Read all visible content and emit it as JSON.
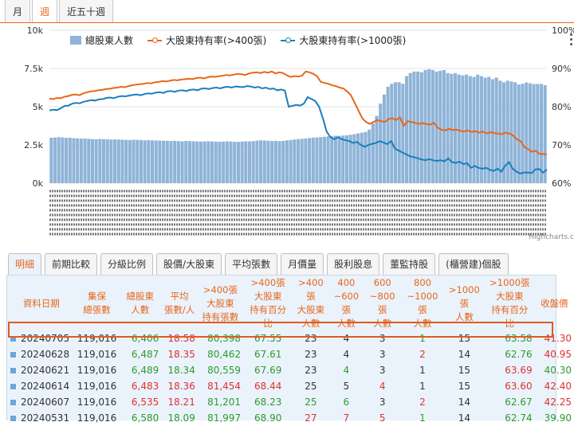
{
  "top_tabs": [
    "月",
    "週",
    "近五十週"
  ],
  "active_top_tab": 1,
  "credit": "Highcharts.c",
  "chart_data": {
    "type": "bar+line",
    "series": [
      {
        "name": "總股東人數",
        "axis": "left",
        "color": "#8fb4d8",
        "values": [
          2970,
          2980,
          3010,
          2990,
          2960,
          2970,
          2940,
          2930,
          2910,
          2920,
          2900,
          2880,
          2870,
          2890,
          2880,
          2870,
          2850,
          2860,
          2850,
          2840,
          2830,
          2820,
          2840,
          2830,
          2820,
          2800,
          2810,
          2800,
          2790,
          2780,
          2780,
          2770,
          2760,
          2770,
          2750,
          2740,
          2760,
          2750,
          2740,
          2730,
          2720,
          2730,
          2740,
          2730,
          2720,
          2710,
          2720,
          2730,
          2720,
          2710,
          2700,
          2720,
          2740,
          2730,
          2750,
          2780,
          2800,
          2790,
          2780,
          2760,
          2770,
          2750,
          2760,
          2800,
          2820,
          2860,
          2880,
          2900,
          2920,
          2950,
          2980,
          2990,
          3010,
          3030,
          3060,
          3080,
          3100,
          3090,
          3110,
          3130,
          3160,
          3200,
          3250,
          3300,
          3350,
          3500,
          3900,
          4400,
          5200,
          5800,
          6300,
          6500,
          6600,
          6600,
          6500,
          7000,
          7200,
          7300,
          7300,
          7250,
          7400,
          7450,
          7400,
          7300,
          7350,
          7400,
          7200,
          7150,
          7200,
          7100,
          7050,
          7100,
          7000,
          6950,
          7100,
          7000,
          6900,
          6950,
          6800,
          6900,
          6700,
          6600,
          6700,
          6650,
          6600,
          6450,
          6500,
          6580,
          6535,
          6483,
          6489,
          6487,
          6406
        ]
      },
      {
        "name": "大股東持有率(>400張)",
        "axis": "right",
        "color": "#e8661a",
        "values": [
          82.1,
          82.0,
          82.3,
          82.2,
          82.6,
          82.8,
          83.1,
          83.2,
          83.0,
          83.5,
          83.8,
          84.0,
          84.1,
          84.3,
          84.4,
          84.6,
          84.7,
          84.9,
          85.0,
          85.2,
          85.1,
          85.4,
          85.6,
          85.8,
          85.9,
          86.0,
          86.2,
          86.1,
          86.4,
          86.5,
          86.7,
          86.6,
          86.8,
          87.0,
          86.9,
          87.1,
          87.2,
          87.3,
          87.2,
          87.5,
          87.6,
          87.4,
          87.7,
          87.9,
          87.8,
          88.0,
          88.1,
          88.3,
          88.2,
          88.4,
          88.6,
          88.5,
          88.3,
          88.7,
          88.9,
          89.0,
          88.8,
          89.1,
          88.9,
          89.2,
          88.7,
          89.0,
          88.8,
          88.2,
          87.8,
          88.0,
          87.9,
          88.1,
          89.2,
          89.0,
          88.6,
          88.0,
          86.5,
          86.2,
          86.0,
          85.6,
          85.4,
          85.0,
          84.8,
          84.0,
          83.0,
          81.0,
          79.0,
          77.0,
          76.0,
          75.5,
          76.0,
          76.5,
          76.2,
          76.0,
          76.8,
          77.0,
          76.5,
          77.2,
          75.0,
          76.2,
          76.0,
          75.8,
          75.5,
          75.7,
          75.5,
          75.3,
          75.8,
          74.5,
          74.0,
          73.8,
          74.2,
          73.9,
          74.0,
          73.7,
          73.5,
          73.8,
          73.4,
          73.6,
          73.2,
          73.5,
          73.0,
          73.3,
          73.1,
          73.0,
          72.8,
          73.2,
          73.0,
          72.5,
          71.5,
          71.0,
          69.5,
          68.9,
          68.23,
          68.44,
          67.69,
          67.61,
          67.55
        ]
      },
      {
        "name": "大股東持有率(>1000張)",
        "axis": "right",
        "color": "#1a7fbd",
        "values": [
          79.0,
          79.2,
          79.1,
          79.6,
          80.2,
          80.3,
          80.8,
          81.0,
          80.9,
          81.3,
          81.5,
          81.7,
          81.6,
          81.9,
          82.0,
          82.3,
          82.4,
          82.2,
          82.6,
          82.8,
          82.7,
          82.9,
          83.1,
          83.2,
          83.0,
          83.3,
          83.5,
          83.4,
          83.7,
          83.8,
          83.6,
          84.0,
          84.1,
          83.9,
          84.2,
          84.3,
          84.1,
          84.4,
          84.5,
          84.3,
          84.7,
          84.8,
          84.6,
          84.9,
          85.0,
          84.8,
          85.1,
          85.2,
          85.0,
          85.3,
          85.2,
          85.1,
          85.4,
          85.3,
          85.0,
          85.2,
          84.8,
          85.0,
          84.6,
          84.8,
          84.3,
          84.5,
          84.2,
          80.0,
          80.2,
          80.5,
          80.3,
          80.8,
          82.5,
          82.0,
          81.5,
          80.0,
          77.0,
          73.5,
          72.0,
          71.5,
          72.0,
          71.5,
          71.2,
          71.0,
          70.5,
          70.8,
          70.0,
          69.5,
          70.0,
          70.3,
          70.5,
          71.0,
          70.6,
          70.2,
          71.0,
          69.0,
          68.5,
          68.0,
          67.5,
          67.0,
          66.8,
          66.5,
          66.2,
          66.0,
          66.3,
          66.0,
          65.8,
          66.0,
          65.7,
          66.5,
          65.5,
          65.3,
          65.6,
          65.0,
          65.2,
          64.0,
          64.5,
          64.0,
          63.8,
          64.0,
          63.5,
          63.2,
          63.8,
          63.0,
          64.5,
          65.5,
          63.8,
          63.0,
          62.5,
          62.8,
          62.74,
          62.67,
          63.6,
          63.69,
          62.76,
          63.58
        ]
      }
    ],
    "left_axis": {
      "ticks": [
        "0k",
        "2.5k",
        "5k",
        "7.5k",
        "10k"
      ],
      "range": [
        0,
        10000
      ]
    },
    "right_axis": {
      "ticks": [
        "60%",
        "70%",
        "80%",
        "90%",
        "100%"
      ],
      "range": [
        60,
        100
      ]
    },
    "grid": true,
    "legend": "top"
  },
  "sub_tabs": [
    "明細",
    "前期比較",
    "分級比例",
    "股價/大股東",
    "平均張數",
    "月價量",
    "股利股息",
    "董監持股",
    "(櫃營建)個股"
  ],
  "active_sub_tab": 0,
  "table": {
    "headers": [
      [
        "資料日期"
      ],
      [
        "集保",
        "總張數"
      ],
      [
        "總股東",
        "人數"
      ],
      [
        "平均",
        "張數/人"
      ],
      [
        ">400張",
        "大股東",
        "持有張數"
      ],
      [
        ">400張",
        "大股東",
        "持有百分比"
      ],
      [
        ">400張",
        "大股東",
        "人數"
      ],
      [
        "400",
        "~600張",
        "人數"
      ],
      [
        "600",
        "~800張",
        "人數"
      ],
      [
        "800",
        "~1000張",
        "人數"
      ],
      [
        ">1000張",
        "人數"
      ],
      [
        ">1000張",
        "大股東",
        "持有百分比"
      ],
      [
        "收盤價"
      ]
    ],
    "rows": [
      [
        "20240705",
        "119,016",
        "6,406",
        "18.58",
        "80,398",
        "67.55",
        "23",
        "4",
        "3",
        "1",
        "15",
        "63.58",
        "41.30"
      ],
      [
        "20240628",
        "119,016",
        "6,487",
        "18.35",
        "80,462",
        "67.61",
        "23",
        "4",
        "3",
        "2",
        "14",
        "62.76",
        "40.95"
      ],
      [
        "20240621",
        "119,016",
        "6,489",
        "18.34",
        "80,559",
        "67.69",
        "23",
        "4",
        "3",
        "1",
        "15",
        "63.69",
        "40.30"
      ],
      [
        "20240614",
        "119,016",
        "6,483",
        "18.36",
        "81,454",
        "68.44",
        "25",
        "5",
        "4",
        "1",
        "15",
        "63.60",
        "42.40"
      ],
      [
        "20240607",
        "119,016",
        "6,535",
        "18.21",
        "81,201",
        "68.23",
        "25",
        "6",
        "3",
        "2",
        "14",
        "62.67",
        "42.25"
      ],
      [
        "20240531",
        "119,016",
        "6,580",
        "18.09",
        "81,997",
        "68.90",
        "27",
        "7",
        "5",
        "1",
        "14",
        "62.74",
        "39.90"
      ]
    ],
    "row_colors": [
      [
        "c",
        "c",
        "g",
        "r",
        "g",
        "g",
        "c",
        "c",
        "c",
        "g",
        "c",
        "g",
        "r"
      ],
      [
        "c",
        "c",
        "g",
        "r",
        "g",
        "g",
        "c",
        "c",
        "c",
        "r",
        "c",
        "g",
        "r"
      ],
      [
        "c",
        "c",
        "g",
        "g",
        "g",
        "g",
        "c",
        "g",
        "c",
        "c",
        "c",
        "r",
        "g"
      ],
      [
        "c",
        "c",
        "r",
        "r",
        "r",
        "r",
        "c",
        "c",
        "r",
        "c",
        "c",
        "r",
        "r"
      ],
      [
        "c",
        "c",
        "r",
        "r",
        "g",
        "g",
        "g",
        "g",
        "c",
        "r",
        "c",
        "g",
        "r"
      ],
      [
        "c",
        "c",
        "g",
        "g",
        "g",
        "g",
        "r",
        "r",
        "r",
        "g",
        "c",
        "g",
        "g"
      ]
    ]
  }
}
